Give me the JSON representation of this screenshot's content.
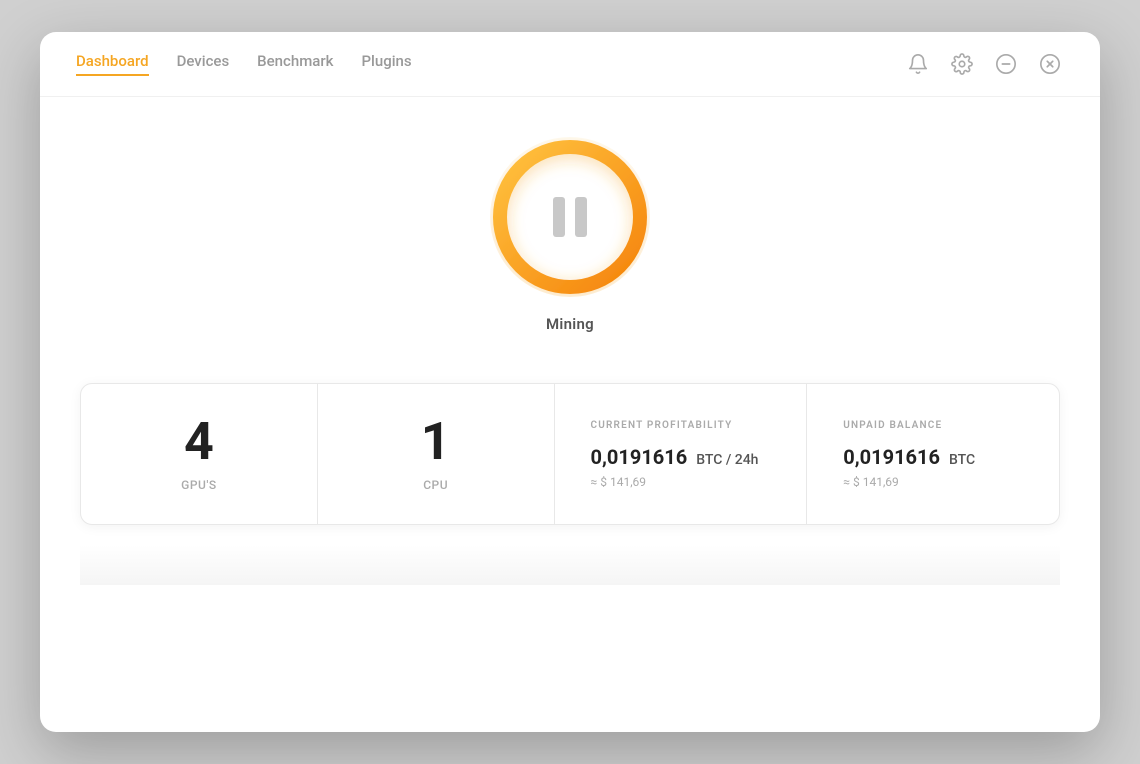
{
  "nav": {
    "tabs": [
      {
        "label": "Dashboard",
        "active": true
      },
      {
        "label": "Devices",
        "active": false
      },
      {
        "label": "Benchmark",
        "active": false
      },
      {
        "label": "Plugins",
        "active": false
      }
    ]
  },
  "mining": {
    "state": "paused",
    "label": "Mining"
  },
  "stats": {
    "gpus": {
      "count": "4",
      "label": "GPU'S"
    },
    "cpu": {
      "count": "1",
      "label": "CPU"
    },
    "profitability": {
      "title": "CURRENT PROFITABILITY",
      "value": "0,0191616",
      "unit": "BTC / 24h",
      "fiat": "≈ $ 141,69"
    },
    "balance": {
      "title": "UNPAID BALANCE",
      "value": "0,0191616",
      "unit": "BTC",
      "fiat": "≈ $ 141,69"
    }
  },
  "icons": {
    "bell": "bell",
    "settings": "gear",
    "minimize": "minus-circle",
    "close": "x-circle"
  }
}
